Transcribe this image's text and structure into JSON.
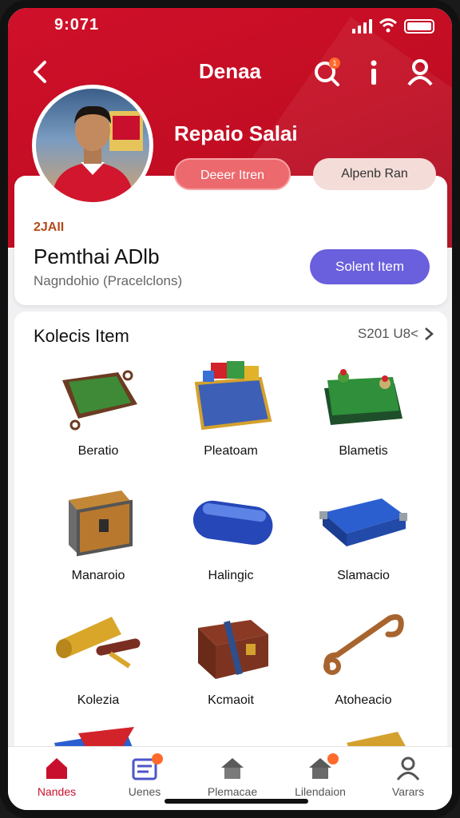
{
  "status": {
    "time": "9:071"
  },
  "nav": {
    "title": "Denaa",
    "notif_badge": "1"
  },
  "profile": {
    "name": "Repaio Salai",
    "pill_primary": "Deeer Itren",
    "pill_secondary": "Alpenb Ran"
  },
  "info": {
    "tag": "2JAII",
    "heading": "Pemthai ADlb",
    "sub": "Nagndohio   (Pracelclons)",
    "button": "Solent Item"
  },
  "collection": {
    "title": "Kolecis Item",
    "more": "S201 U8<",
    "items": [
      {
        "label": "Beratio",
        "icon": "green-mat-icon"
      },
      {
        "label": "Pleatoam",
        "icon": "toy-chest-icon"
      },
      {
        "label": "Blametis",
        "icon": "game-table-icon"
      },
      {
        "label": "Manaroio",
        "icon": "treasure-chest-icon"
      },
      {
        "label": "Halingic",
        "icon": "blue-capsule-icon"
      },
      {
        "label": "Slamacio",
        "icon": "blue-tray-icon"
      },
      {
        "label": "Kolezia",
        "icon": "gold-scroll-icon"
      },
      {
        "label": "Kcmaoit",
        "icon": "leather-bag-icon"
      },
      {
        "label": "Atoheacio",
        "icon": "copper-hook-icon"
      }
    ]
  },
  "tabs": [
    {
      "label": "Nandes",
      "icon": "home-icon",
      "active": true
    },
    {
      "label": "Uenes",
      "icon": "list-icon",
      "badge": true
    },
    {
      "label": "Plemacae",
      "icon": "house-icon"
    },
    {
      "label": "Lilendaion",
      "icon": "store-icon",
      "badge": true
    },
    {
      "label": "Varars",
      "icon": "user-icon"
    }
  ],
  "colors": {
    "brand_red": "#c8102e",
    "accent_purple": "#6a5fdc",
    "pill_red": "#ec6a6e"
  }
}
